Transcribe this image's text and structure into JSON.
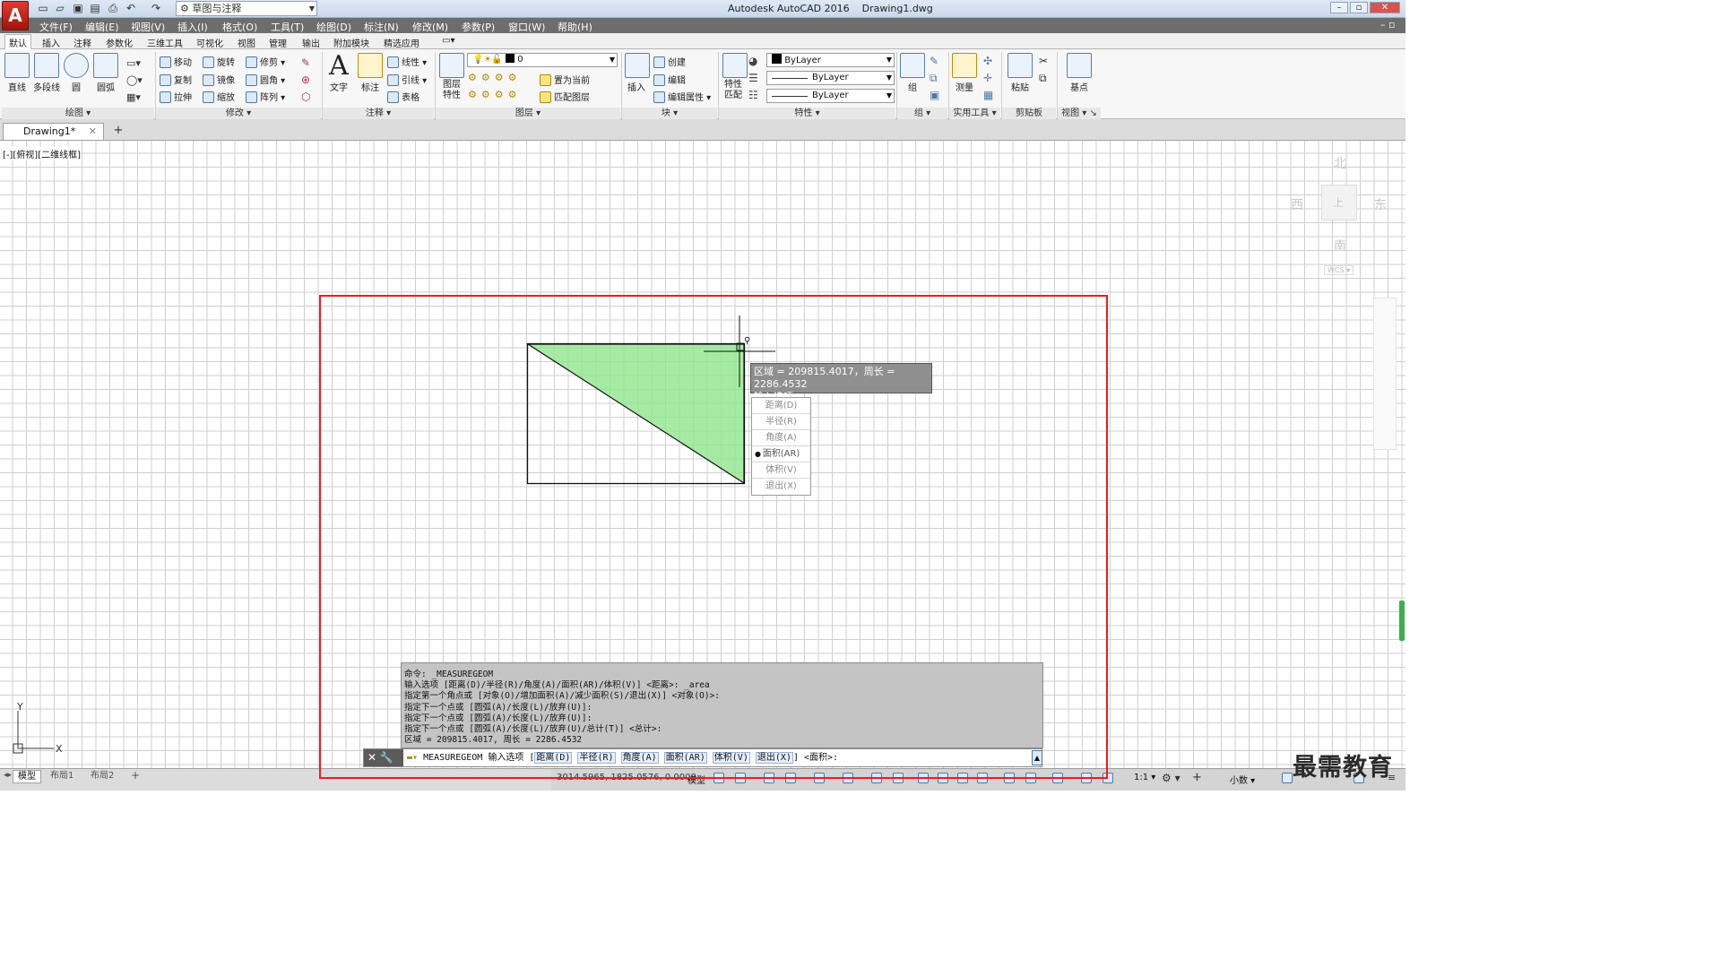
{
  "app": {
    "window_title": "Autodesk AutoCAD 2016",
    "file": "Drawing1.dwg",
    "logo": "A",
    "workspace": "草图与注释"
  },
  "menu": [
    "文件(F)",
    "编辑(E)",
    "视图(V)",
    "插入(I)",
    "格式(O)",
    "工具(T)",
    "绘图(D)",
    "标注(N)",
    "修改(M)",
    "参数(P)",
    "窗口(W)",
    "帮助(H)"
  ],
  "ribbon_tabs": [
    "默认",
    "插入",
    "注释",
    "参数化",
    "三维工具",
    "可视化",
    "视图",
    "管理",
    "输出",
    "附加模块",
    "精选应用"
  ],
  "ribbon": {
    "draw": {
      "line": "直线",
      "polyline": "多段线",
      "circle": "圆",
      "arc": "圆弧",
      "panel": "绘图"
    },
    "modify": {
      "move": "移动",
      "rotate": "旋转",
      "trim": "修剪",
      "copy": "复制",
      "mirror": "镜像",
      "fillet": "圆角",
      "stretch": "拉伸",
      "scale": "缩放",
      "array": "阵列",
      "panel": "修改"
    },
    "annotation": {
      "text": "文字",
      "dimension": "标注",
      "linear": "线性",
      "leader": "引线",
      "table": "表格",
      "panel": "注释"
    },
    "layers": {
      "properties": "图层\n特性",
      "current_layer": "0",
      "set_current": "置为当前",
      "match_layer": "匹配图层",
      "panel": "图层"
    },
    "block": {
      "insert": "插入",
      "create": "创建",
      "edit": "编辑",
      "edit_attr": "编辑属性",
      "panel": "块"
    },
    "properties": {
      "match": "特性\n匹配",
      "color": "ByLayer",
      "linetype": "ByLayer",
      "lineweight": "ByLayer",
      "panel": "特性"
    },
    "groups": {
      "group": "组",
      "panel": "组"
    },
    "utilities": {
      "measure": "测量",
      "panel": "实用工具"
    },
    "clipboard": {
      "paste": "粘贴",
      "panel": "剪贴板"
    },
    "view": {
      "base": "基点",
      "panel": "视图"
    }
  },
  "doc_tab": "Drawing1*",
  "viewport_label": "[-][俯视][二维线框]",
  "viewcube": {
    "north": "北",
    "south": "南",
    "east": "东",
    "west": "西",
    "top": "上",
    "wcs": "WCS"
  },
  "tooltip": {
    "line1": "区域 = 209815.4017，周长 = 2286.4532",
    "line2": "输入选项"
  },
  "options": [
    "距离(D)",
    "半径(R)",
    "角度(A)",
    "面积(AR)",
    "体积(V)",
    "退出(X)"
  ],
  "command_history": [
    "命令: _MEASUREGEOM",
    "输入选项 [距离(D)/半径(R)/角度(A)/面积(AR)/体积(V)] <距离>: _area",
    "指定第一个角点或 [对象(O)/增加面积(A)/减少面积(S)/退出(X)] <对象(O)>:",
    "指定下一个点或 [圆弧(A)/长度(L)/放弃(U)]:",
    "指定下一个点或 [圆弧(A)/长度(L)/放弃(U)]:",
    "指定下一个点或 [圆弧(A)/长度(L)/放弃(U)/总计(T)] <总计>:",
    "区域 = 209815.4017, 周长 = 2286.4532"
  ],
  "command_line": {
    "prefix": "MEASUREGEOM 输入选项 [",
    "suffix": "] <面积>:"
  },
  "layout_tabs": [
    "模型",
    "布局1",
    "布局2"
  ],
  "status": {
    "coords": "3014.5965, 1825.0576, 0.0000",
    "model": "模型",
    "scale": "1:1",
    "units": "小数"
  },
  "watermark": "最需教育",
  "ucs": {
    "x": "X",
    "y": "Y"
  }
}
